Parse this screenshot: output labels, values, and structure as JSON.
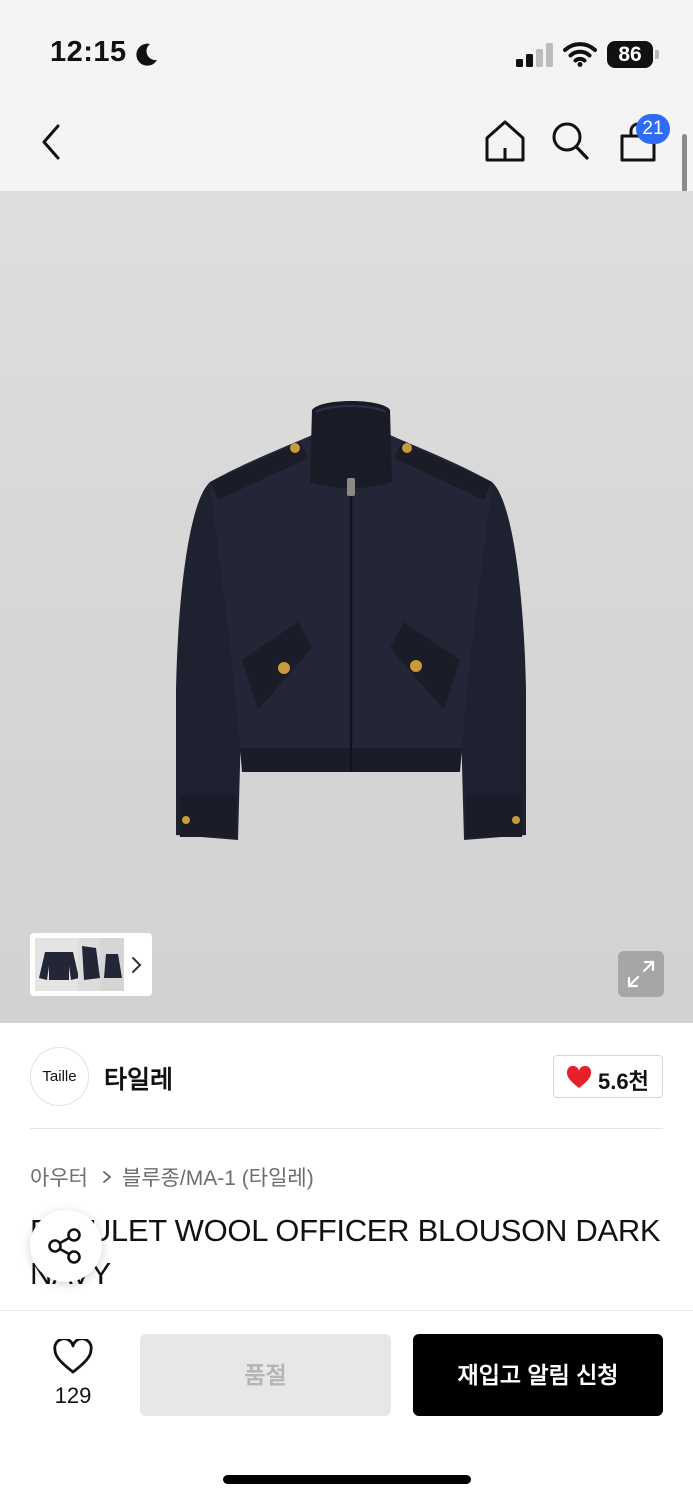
{
  "status_bar": {
    "time": "12:15",
    "battery": "86"
  },
  "nav": {
    "cart_badge": "21"
  },
  "brand": {
    "logo_text": "Taille",
    "name": "타일레",
    "likes": "5.6천"
  },
  "breadcrumb": {
    "category": "아우터",
    "subcategory": "블루종/MA-1 (타일레)"
  },
  "product": {
    "title": "EPAULET WOOL OFFICER BLOUSON DARK NAVY"
  },
  "actions": {
    "wishlist_count": "129",
    "soldout_label": "품절",
    "restock_label": "재입고 알림 신청"
  },
  "colors": {
    "accent_badge": "#2f6cf5",
    "heart": "#e8202a",
    "primary_button": "#000000"
  }
}
